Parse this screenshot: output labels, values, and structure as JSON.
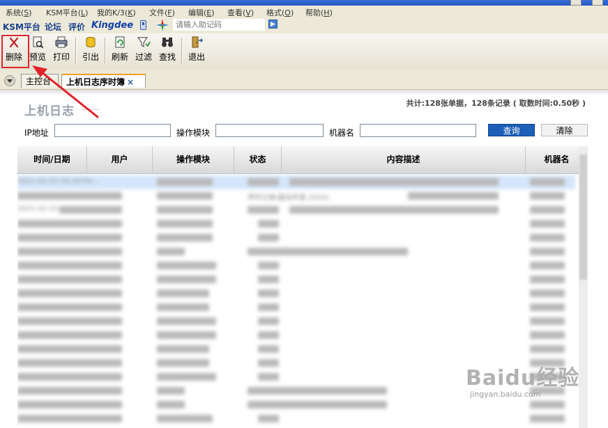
{
  "menu": {
    "items": [
      {
        "label": "系统",
        "key": "S"
      },
      {
        "label": "KSM平台",
        "key": "L"
      },
      {
        "label": "我的K/3",
        "key": "K"
      },
      {
        "label": "文件",
        "key": "F"
      },
      {
        "label": "编辑",
        "key": "E"
      },
      {
        "label": "查看",
        "key": "V"
      },
      {
        "label": "格式",
        "key": "O"
      },
      {
        "label": "帮助",
        "key": "H"
      }
    ]
  },
  "linkbar": {
    "ksm": "KSM平台",
    "forum": "论坛",
    "evaluate": "评价",
    "brand": "Kingdee",
    "search_placeholder": "请输入助记码",
    "go": "▶"
  },
  "toolbar": {
    "delete": "删除",
    "preview": "预览",
    "print": "打印",
    "export": "引出",
    "refresh": "刷新",
    "filter": "过滤",
    "find": "查找",
    "exit": "退出"
  },
  "tabs": {
    "main_console": "主控台",
    "current": "上机日志序时簿",
    "close": "×"
  },
  "page": {
    "title": "上机日志",
    "summary": "共计:128张单据，128条记录 ( 取数时间:0.50秒 )"
  },
  "filters": {
    "ip_label": "IP地址",
    "module_label": "操作模块",
    "machine_label": "机器名",
    "ip_value": "",
    "module_value": "",
    "machine_value": "",
    "query_button": "查询",
    "clear_button": "清除"
  },
  "grid": {
    "columns": [
      "时间/日期",
      "用户",
      "操作模块",
      "状态",
      "内容描述",
      "机器名"
    ],
    "rows": [
      {
        "time": "2021-02-23 16:16:Fei..."
      },
      {
        "time": "",
        "desc": "序时记录(最站年度:2020)"
      },
      {
        "time": "2021-02-23"
      }
    ]
  },
  "watermark": {
    "logo": "Baidu经验",
    "url": "jingyan.baidu.com"
  },
  "colors": {
    "highlight": "#e0242a",
    "query_button": "#1c5fb8",
    "tab_accent": "#f0a020",
    "selected_row": "#d4e6fb"
  }
}
